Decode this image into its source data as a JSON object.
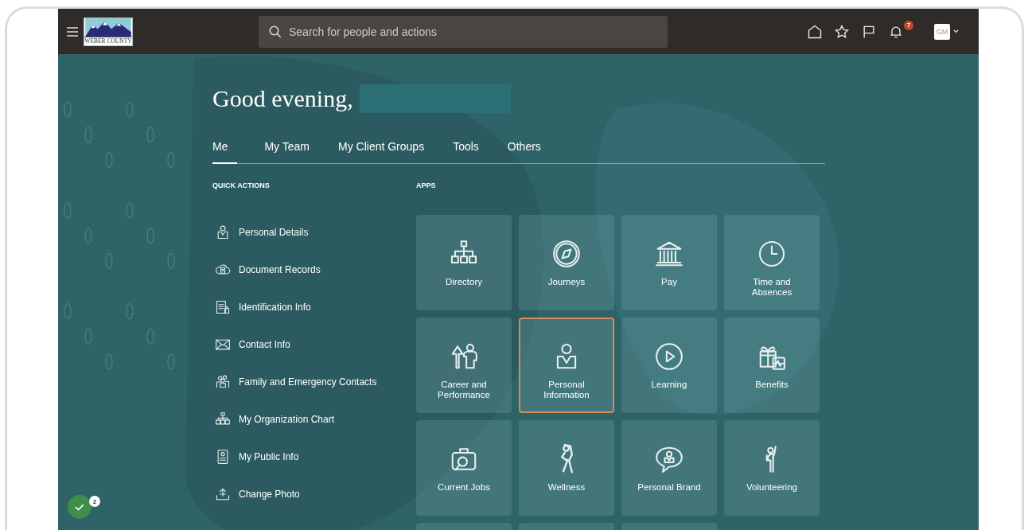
{
  "header": {
    "logo_text": "WEBER COUNTY",
    "search": {
      "placeholder": "Search for people and actions"
    },
    "notifications": {
      "badge": "7"
    },
    "avatar": {
      "initials": "GM"
    }
  },
  "greeting": {
    "text": "Good evening,"
  },
  "tabs": [
    {
      "label": "Me",
      "selected": true
    },
    {
      "label": "My Team",
      "selected": false
    },
    {
      "label": "My Client Groups",
      "selected": false
    },
    {
      "label": "Tools",
      "selected": false
    },
    {
      "label": "Others",
      "selected": false
    }
  ],
  "quick_actions": {
    "title": "QUICK ACTIONS",
    "items": [
      {
        "label": "Personal Details"
      },
      {
        "label": "Document Records"
      },
      {
        "label": "Identification Info"
      },
      {
        "label": "Contact Info"
      },
      {
        "label": "Family and Emergency Contacts"
      },
      {
        "label": "My Organization Chart"
      },
      {
        "label": "My Public Info"
      },
      {
        "label": "Change Photo"
      }
    ]
  },
  "apps": {
    "title": "APPS",
    "tiles": [
      {
        "kind": "tile",
        "label": "Directory",
        "selected": false
      },
      {
        "kind": "tile",
        "label": "Journeys",
        "selected": false
      },
      {
        "kind": "tile",
        "label": "Pay",
        "selected": false
      },
      {
        "kind": "tile",
        "label": "Time and Absences",
        "selected": false
      },
      {
        "kind": "tile",
        "label": "Career and Performance",
        "selected": false
      },
      {
        "kind": "tile",
        "label": "Personal Information",
        "selected": true
      },
      {
        "kind": "tile",
        "label": "Learning",
        "selected": false
      },
      {
        "kind": "tile",
        "label": "Benefits",
        "selected": false
      },
      {
        "kind": "tile",
        "label": "Current Jobs",
        "selected": false
      },
      {
        "kind": "tile",
        "label": "Wellness",
        "selected": false
      },
      {
        "kind": "tile",
        "label": "Personal Brand",
        "selected": false
      },
      {
        "kind": "tile",
        "label": "Volunteering",
        "selected": false
      },
      {
        "kind": "cut"
      },
      {
        "kind": "cut"
      },
      {
        "kind": "cut"
      }
    ]
  },
  "task_widget": {
    "badge": "2"
  }
}
